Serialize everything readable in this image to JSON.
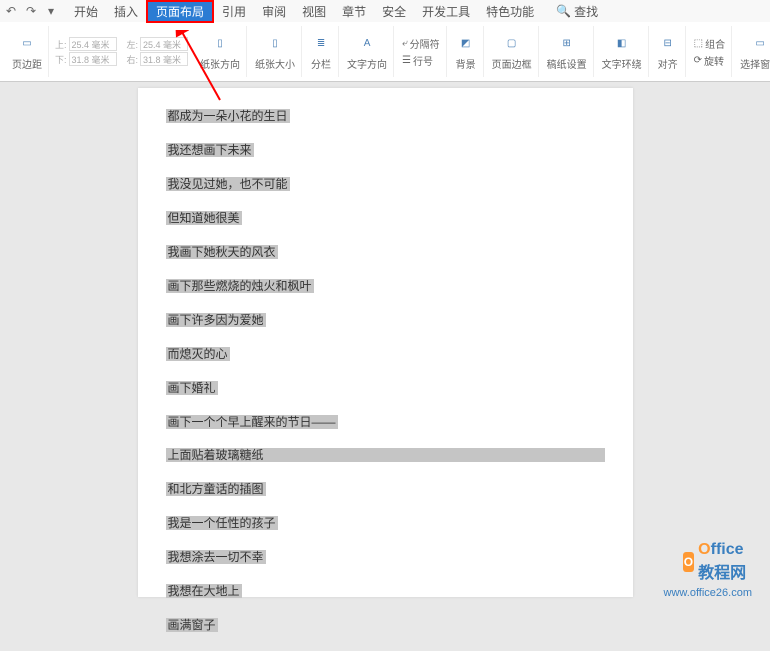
{
  "tabs": {
    "kaishi": "开始",
    "charu": "插入",
    "yemianbuju": "页面布局",
    "yinyong": "引用",
    "shenyue": "审阅",
    "shitu": "视图",
    "zhangjie": "章节",
    "anquan": "安全",
    "kaifagongju": "开发工具",
    "tesegongneng": "特色功能",
    "chazhao": "查找"
  },
  "margins": {
    "label": "页边距",
    "top": "25.4 毫米",
    "bottom": "31.8 毫米",
    "left": "25.4 毫米",
    "right": "31.8 毫米"
  },
  "ribbon": {
    "zhizhangfangxiang": "纸张方向",
    "zhizhangdaxiao": "纸张大小",
    "fenlan": "分栏",
    "wenzifangxiang": "文字方向",
    "fengefu": "分隔符",
    "hanghao": "行号",
    "beijing": "背景",
    "yemianbiankuang": "页面边框",
    "gaozhishezhi": "稿纸设置",
    "wenzihuanrao": "文字环绕",
    "duiqi": "对齐",
    "zuhe": "组合",
    "xuanzhuan": "旋转",
    "xuanzechuangge": "选择窗格"
  },
  "doc": {
    "lines": [
      "都成为一朵小花的生日",
      "我还想画下未来",
      "我没见过她，也不可能",
      "但知道她很美",
      "我画下她秋天的风衣",
      "画下那些燃烧的烛火和枫叶",
      "画下许多因为爱她",
      "而熄灭的心",
      "画下婚礼",
      "画下一个个早上醒来的节日——",
      "上面贴着玻璃糖纸",
      "和北方童话的插图",
      "我是一个任性的孩子",
      "我想涂去一切不幸",
      "我想在大地上",
      "画满窗子"
    ],
    "wide_index": 10
  },
  "watermark": {
    "brand_o": "O",
    "brand_rest": "ffice教程网",
    "url": "www.office26.com"
  }
}
